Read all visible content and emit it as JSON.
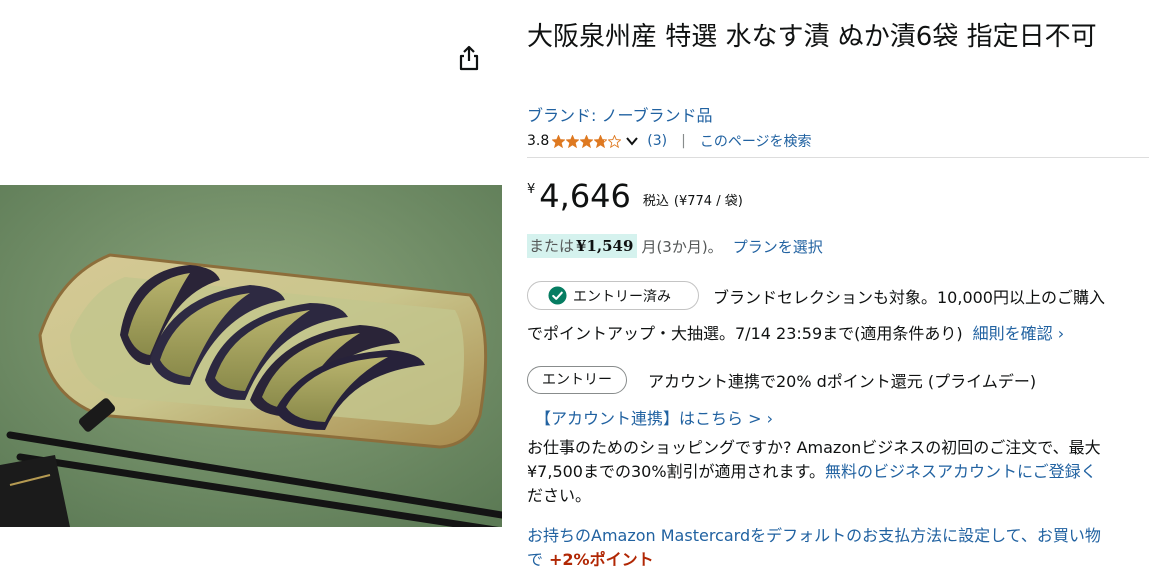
{
  "product": {
    "title": "大阪泉州産 特選 水なす漬 ぬか漬6袋 指定日不可",
    "brand": "ブランド: ノーブランド品",
    "rating": "3.8",
    "stars_value": 3.8,
    "review_count": "(3)",
    "separator": "|",
    "search_page": "このページを検索"
  },
  "price": {
    "symbol": "¥",
    "whole": "4,646",
    "tax_label": "税込",
    "unit_price": "(¥774 / 袋)"
  },
  "installment": {
    "prefix": "または",
    "amount": "¥1,549",
    "suffix": "月(3か月)。",
    "plan_link": "プランを選択"
  },
  "promo_entry_done": {
    "button_label": "エントリー済み",
    "text_a": "ブランドセレクションも対象。10,000円以上のご購入",
    "text_b": "でポイントアップ・大抽選。7/14 23:59まで(適用条件あり)",
    "details_link": "細則を確認 ›"
  },
  "promo_entry": {
    "button_label": "エントリー",
    "text": "アカウント連携で20% dポイント還元 (プライムデー)",
    "account_link": "【アカウント連携】はこちら > ›"
  },
  "business": {
    "line1": "お仕事のためのショッピングですか? Amazonビジネスの初回のご注文で、最大",
    "line2_text": "¥7,500までの30%割引が適用されます。",
    "line2_link": "無料のビジネスアカウントにご登録く",
    "line3_link": "ださい。"
  },
  "card": {
    "line1": "お持ちのAmazon Mastercardをデフォルトのお支払方法に設定して、お買い物",
    "line2_prefix": "で",
    "points": "+2%ポイント"
  },
  "colors": {
    "link": "#2162a1",
    "star": "#de7921",
    "installment_bg": "#d5f2ee",
    "check_green": "#067d62",
    "points_red": "#b12704"
  },
  "icons": [
    "share-icon",
    "star-icon",
    "chevron-down-icon",
    "check-circle-icon"
  ]
}
